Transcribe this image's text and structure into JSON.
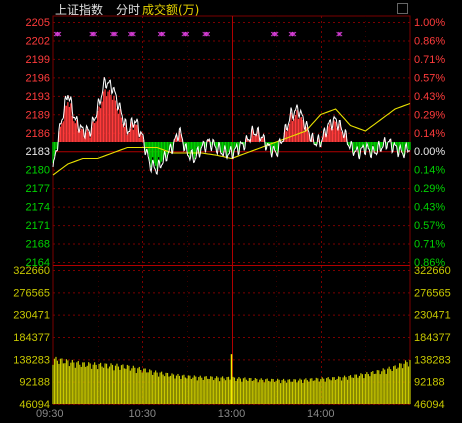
{
  "header": {
    "index_name": "上证指数",
    "period_label": "分时",
    "volume_label": "成交额(万)"
  },
  "colors": {
    "up": "#ff3b3b",
    "down": "#00d200",
    "neutral": "#e8e8e8",
    "price_line": "#ffffff",
    "avg_line": "#e8e000",
    "volume": "#c8c800",
    "marker": "#e040e0",
    "grid": "#7a0000"
  },
  "chart_data": {
    "type": "line",
    "title": "",
    "xlabel": "",
    "ylabel": "",
    "base_price": 2183,
    "price_ticks_left": [
      "2205",
      "2202",
      "2199",
      "2196",
      "2193",
      "2189",
      "2186",
      "2183",
      "2180",
      "2177",
      "2174",
      "2171",
      "2168",
      "2164"
    ],
    "pct_ticks_right": [
      "1.00%",
      "0.86%",
      "0.71%",
      "0.57%",
      "0.43%",
      "0.29%",
      "0.14%",
      "0.00%",
      "0.14%",
      "0.29%",
      "0.43%",
      "0.57%",
      "0.71%",
      "0.86%"
    ],
    "ylim": [
      2161.2,
      2204.8
    ],
    "volume_ticks": [
      "322660",
      "276565",
      "230471",
      "184377",
      "138283",
      "92188",
      "46094"
    ],
    "volume_ylim": [
      0,
      322660
    ],
    "x_ticks": [
      "09:30",
      "10:30",
      "13:00",
      "14:00"
    ],
    "session_minutes": 240,
    "series": [
      {
        "key": "price",
        "x": [
          0,
          5,
          10,
          15,
          20,
          25,
          30,
          35,
          40,
          45,
          50,
          55,
          60,
          65,
          70,
          75,
          80,
          85,
          90,
          95,
          100,
          105,
          110,
          115,
          120,
          125,
          130,
          135,
          140,
          145,
          150,
          155,
          160,
          165,
          170,
          175,
          180,
          185,
          190,
          195,
          200,
          205,
          210,
          215,
          220,
          225,
          230,
          235,
          240
        ],
        "values": [
          2178,
          2186,
          2192,
          2187,
          2185,
          2185,
          2189,
          2194,
          2193,
          2189,
          2185,
          2187,
          2184,
          2179,
          2178,
          2180,
          2182,
          2185,
          2181,
          2180,
          2182,
          2183,
          2182,
          2181,
          2181,
          2182,
          2183,
          2185,
          2184,
          2182,
          2181,
          2184,
          2188,
          2189,
          2186,
          2183,
          2183,
          2186,
          2187,
          2185,
          2182,
          2181,
          2182,
          2181,
          2182,
          2183,
          2182,
          2181,
          2182
        ]
      },
      {
        "key": "average",
        "x": [
          0,
          10,
          20,
          30,
          40,
          50,
          60,
          70,
          80,
          90,
          100,
          110,
          120,
          130,
          140,
          150,
          160,
          170,
          180,
          190,
          200,
          210,
          220,
          230,
          240
        ],
        "values": [
          2177,
          2179,
          2180,
          2180,
          2181,
          2182,
          2182,
          2182,
          2181,
          2181,
          2181,
          2180.6,
          2180,
          2181,
          2182,
          2183,
          2184,
          2185,
          2188,
          2189,
          2186,
          2185,
          2187,
          2189,
          2190
        ]
      }
    ],
    "histogram_diff_scale": 0.85,
    "volume": {
      "x": [
        0,
        10,
        20,
        30,
        40,
        50,
        60,
        70,
        80,
        90,
        100,
        110,
        120,
        130,
        140,
        150,
        160,
        170,
        180,
        190,
        200,
        210,
        220,
        230,
        240
      ],
      "values": [
        115000,
        108000,
        102000,
        100000,
        98000,
        95000,
        88000,
        80000,
        74000,
        70000,
        68000,
        67000,
        66000,
        64000,
        62000,
        61000,
        60000,
        62000,
        64000,
        66000,
        70000,
        76000,
        84000,
        94000,
        110000
      ]
    },
    "volume_spike": {
      "x": 120,
      "value": 120000
    },
    "markers": {
      "symbol": "✕",
      "groups": [
        [
          2,
          3,
          4
        ],
        [
          26,
          27,
          28
        ],
        [
          40,
          41,
          42
        ],
        [
          52,
          53,
          54
        ],
        [
          72,
          73,
          74
        ],
        [
          88,
          89,
          90
        ],
        [
          102,
          103,
          104
        ],
        [
          148,
          149,
          150
        ],
        [
          160,
          161,
          162
        ],
        [
          192,
          193
        ]
      ]
    }
  }
}
